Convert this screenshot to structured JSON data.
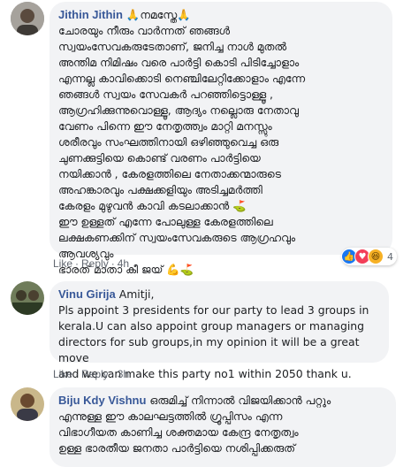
{
  "comments": [
    {
      "author": "Jithin Jithin",
      "name_suffix": "🙏നമസ്തേ🙏",
      "lines": [
        "ചോരയും നീരും വാർന്നത് ഞങ്ങൾ",
        "സ്വയംസേവകരുടേതാണ്, ജനിച്ച നാൾ മുതൽ",
        "അന്തിമ നിമിഷം വരെ പാർട്ടി കൊടി പിടിച്ചോളാം",
        "എന്നല്ല കാവിക്കൊടി നെഞ്ചിലേറ്റിക്കോളാം എന്നേ",
        "ഞങ്ങൾ സ്വയം സേവകർ പറഞ്ഞിട്ടൊള്ളൂ ,",
        "ആഗ്രഹിക്കുന്നുവൊള്ളൂ, ആദ്യം നല്ലൊരു നേതാവു",
        "വേണം പിന്നെ ഈ നേതൃത്ത്വം മാറ്റി മനസ്സും",
        "ശരീരവും സംഘത്തിനായി ഒഴിഞ്ഞുവെച്ച ഒരു",
        "ചുണക്കുട്ടിയെ കൊണ്ട് വരണം പാർട്ടിയെ",
        "നയിക്കാൻ , കേരളത്തിലെ നേതാക്കന്മാരുടെ",
        "അഹങ്കാരവും പക്ഷക്കളിയും അടിച്ചമർത്തി",
        "കേരളം മുഴുവൻ കാവി കടലാക്കാൻ ⛳",
        "ഈ ഉള്ളത് എന്നേ പോലുള്ള കേരളത്തിലെ",
        "ലക്ഷകണക്കിന് സ്വയംസേവകരുടെ ആഗ്രഹവും",
        "ആവശ്യവും",
        "ഭാരത് മാതാ കീ ജയ് 💪⛳"
      ],
      "actions": {
        "like": "Like",
        "reply": "Reply",
        "time": "4h"
      },
      "reaction_count": "4"
    },
    {
      "author": "Vinu Girija",
      "name_suffix": "Amitji,",
      "lines": [
        "Pls appoint 3 presidents for our party to lead 3 groups in",
        "kerala.U can also appoint group managers or managing",
        "directors for sub groups,in my opinion it will be a great move",
        "and we can make this party no1 within 2050 thank u."
      ],
      "actions": {
        "like": "Like",
        "reply": "Reply",
        "time": "3h"
      }
    },
    {
      "author": "Biju Kdy Vishnu",
      "name_suffix": "ഒരുമിച്ച് നിന്നാൽ വിജയിക്കാൻ പറ്റും",
      "lines": [
        "എന്നുള്ള ഈ കാലഘട്ടത്തിൽ ഗ്രൂപ്പിസം എന്ന",
        "വിഭാഗീയത കാണിച്ച ശക്തമായ കേന്ദ്ര നേതൃത്വം",
        "ഉള്ള ഭാരതീയ ജനതാ പാർട്ടിയെ നശിപ്പിക്കരുത്"
      ]
    }
  ]
}
